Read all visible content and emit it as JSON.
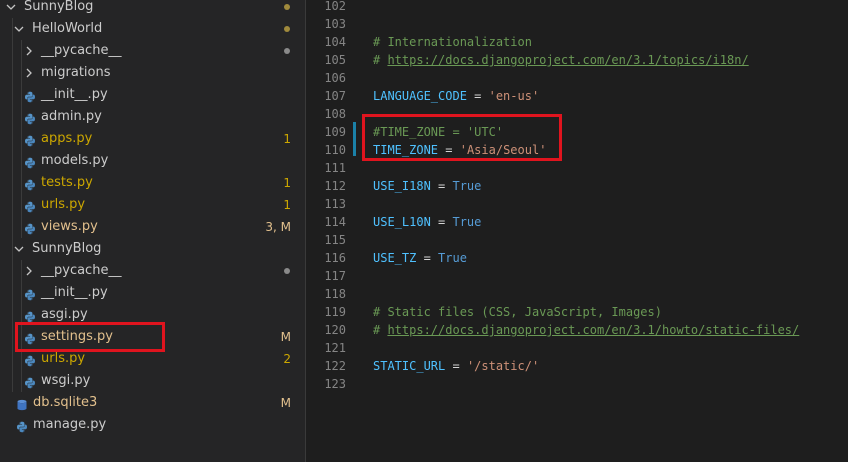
{
  "explorer": {
    "items": [
      {
        "label": "SunnyBlog",
        "kind": "folder",
        "open": true,
        "badge": "",
        "dot": true
      },
      {
        "label": "HelloWorld",
        "kind": "folder",
        "open": true,
        "badge": "",
        "dot": true
      },
      {
        "label": "__pycache__",
        "kind": "folder",
        "open": false,
        "badge": "",
        "dot": true
      },
      {
        "label": "migrations",
        "kind": "folder",
        "open": false,
        "badge": "",
        "dot": false
      },
      {
        "label": "__init__.py",
        "kind": "py",
        "badge": ""
      },
      {
        "label": "admin.py",
        "kind": "py",
        "badge": ""
      },
      {
        "label": "apps.py",
        "kind": "py",
        "badge": "1"
      },
      {
        "label": "models.py",
        "kind": "py",
        "badge": ""
      },
      {
        "label": "tests.py",
        "kind": "py",
        "badge": "1"
      },
      {
        "label": "urls.py",
        "kind": "py",
        "badge": "1"
      },
      {
        "label": "views.py",
        "kind": "py",
        "badge": "3, M"
      },
      {
        "label": "SunnyBlog",
        "kind": "folder",
        "open": true,
        "badge": "",
        "dot": false
      },
      {
        "label": "__pycache__",
        "kind": "folder",
        "open": false,
        "badge": "",
        "dot": true
      },
      {
        "label": "__init__.py",
        "kind": "py",
        "badge": ""
      },
      {
        "label": "asgi.py",
        "kind": "py",
        "badge": ""
      },
      {
        "label": "settings.py",
        "kind": "py",
        "badge": "M"
      },
      {
        "label": "urls.py",
        "kind": "py",
        "badge": "2"
      },
      {
        "label": "wsgi.py",
        "kind": "py",
        "badge": ""
      },
      {
        "label": "db.sqlite3",
        "kind": "db",
        "badge": "M"
      },
      {
        "label": "manage.py",
        "kind": "py",
        "badge": ""
      }
    ]
  },
  "editor": {
    "lines": [
      {
        "n": "102",
        "tokens": []
      },
      {
        "n": "103",
        "tokens": []
      },
      {
        "n": "104",
        "tokens": [
          {
            "t": "# Internationalization",
            "k": "comment"
          }
        ]
      },
      {
        "n": "105",
        "tokens": [
          {
            "t": "# ",
            "k": "comment"
          },
          {
            "t": "https://docs.djangoproject.com/en/3.1/topics/i18n/",
            "k": "link"
          }
        ]
      },
      {
        "n": "106",
        "tokens": []
      },
      {
        "n": "107",
        "tokens": [
          {
            "t": "LANGUAGE_CODE",
            "k": "var"
          },
          {
            "t": " = ",
            "k": "op"
          },
          {
            "t": "'en-us'",
            "k": "str"
          }
        ]
      },
      {
        "n": "108",
        "tokens": []
      },
      {
        "n": "109",
        "tokens": [
          {
            "t": "#TIME_ZONE = 'UTC'",
            "k": "comment"
          }
        ]
      },
      {
        "n": "110",
        "tokens": [
          {
            "t": "TIME_ZONE",
            "k": "var"
          },
          {
            "t": " = ",
            "k": "op"
          },
          {
            "t": "'Asia/Seoul'",
            "k": "str"
          }
        ]
      },
      {
        "n": "111",
        "tokens": []
      },
      {
        "n": "112",
        "tokens": [
          {
            "t": "USE_I18N",
            "k": "var"
          },
          {
            "t": " = ",
            "k": "op"
          },
          {
            "t": "True",
            "k": "const"
          }
        ]
      },
      {
        "n": "113",
        "tokens": []
      },
      {
        "n": "114",
        "tokens": [
          {
            "t": "USE_L10N",
            "k": "var"
          },
          {
            "t": " = ",
            "k": "op"
          },
          {
            "t": "True",
            "k": "const"
          }
        ]
      },
      {
        "n": "115",
        "tokens": []
      },
      {
        "n": "116",
        "tokens": [
          {
            "t": "USE_TZ",
            "k": "var"
          },
          {
            "t": " = ",
            "k": "op"
          },
          {
            "t": "True",
            "k": "const"
          }
        ]
      },
      {
        "n": "117",
        "tokens": []
      },
      {
        "n": "118",
        "tokens": []
      },
      {
        "n": "119",
        "tokens": [
          {
            "t": "# Static files (CSS, JavaScript, Images)",
            "k": "comment"
          }
        ]
      },
      {
        "n": "120",
        "tokens": [
          {
            "t": "# ",
            "k": "comment"
          },
          {
            "t": "https://docs.djangoproject.com/en/3.1/howto/static-files/",
            "k": "link"
          }
        ]
      },
      {
        "n": "121",
        "tokens": []
      },
      {
        "n": "122",
        "tokens": [
          {
            "t": "STATIC_URL",
            "k": "var"
          },
          {
            "t": " = ",
            "k": "op"
          },
          {
            "t": "'/static/'",
            "k": "str"
          }
        ]
      },
      {
        "n": "123",
        "tokens": []
      }
    ]
  },
  "colors": {
    "highlight_box": "#e0141e",
    "comment": "#6a9955",
    "variable": "#4fc1ff",
    "string": "#ce9178",
    "constant": "#569cd6",
    "python_icon": "#5694c8",
    "warning_text": "#cca700",
    "modified_text": "#e2c08d"
  }
}
